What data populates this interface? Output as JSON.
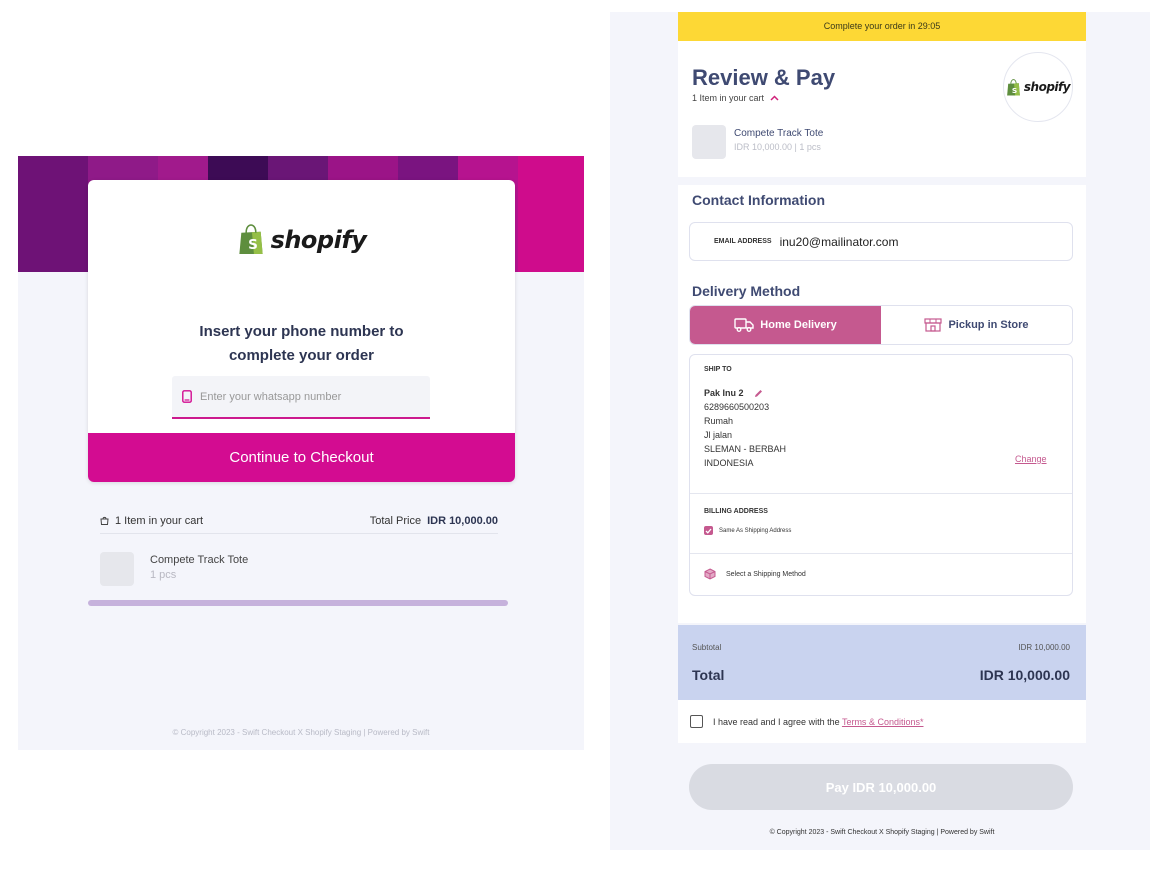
{
  "left": {
    "logo_text": "shopify",
    "title_line1": "Insert your phone number to",
    "title_line2": "complete your order",
    "phone_placeholder": "Enter your whatsapp number",
    "continue_label": "Continue to Checkout",
    "cart_count": "1 Item in your cart",
    "total_price_label": "Total Price",
    "total_price_value": "IDR 10,000.00",
    "item_name": "Compete Track Tote",
    "item_qty": "1 pcs",
    "footer": "© Copyright 2023 - Swift Checkout X Shopify Staging | Powered by Swift"
  },
  "right": {
    "timer_text": "Complete your order in 29:05",
    "title": "Review & Pay",
    "items_in_cart": "1 Item in your cart",
    "logo_text": "shopify",
    "item_name": "Compete Track Tote",
    "item_detail": "IDR 10,000.00 | 1 pcs",
    "contact_heading": "Contact Information",
    "email_label": "EMAIL ADDRESS",
    "email_value": "inu20@mailinator.com",
    "delivery_heading": "Delivery Method",
    "tab_home": "Home Delivery",
    "tab_pickup": "Pickup in Store",
    "ship_to_label": "SHIP TO",
    "address": {
      "name": "Pak Inu 2",
      "phone": "6289660500203",
      "label": "Rumah",
      "street": "Jl jalan",
      "city": "SLEMAN - BERBAH",
      "country": "INDONESIA"
    },
    "change_label": "Change",
    "billing_label": "BILLING ADDRESS",
    "same_as_shipping": "Same As Shipping Address",
    "shipping_method": "Select a Shipping Method",
    "subtotal_label": "Subtotal",
    "subtotal_value": "IDR 10,000.00",
    "total_label": "Total",
    "total_value": "IDR 10,000.00",
    "terms_text": "I have read and I agree with the",
    "terms_link": "Terms & Conditions*",
    "pay_label": "Pay IDR 10,000.00",
    "footer": "© Copyright 2023 - Swift Checkout X Shopify Staging | Powered by Swift"
  },
  "colors": {
    "brand_pink": "#d30c91",
    "accent_rose": "#c5598f",
    "timer_yellow": "#fdd835",
    "totals_blue": "#c9d3ef",
    "title_navy": "#3f4a72"
  },
  "icons": [
    "shopify-bag-icon",
    "phone-icon",
    "bag-icon",
    "chevron-up-icon",
    "truck-icon",
    "store-icon",
    "pencil-icon",
    "checkbox-icon",
    "box-icon"
  ]
}
